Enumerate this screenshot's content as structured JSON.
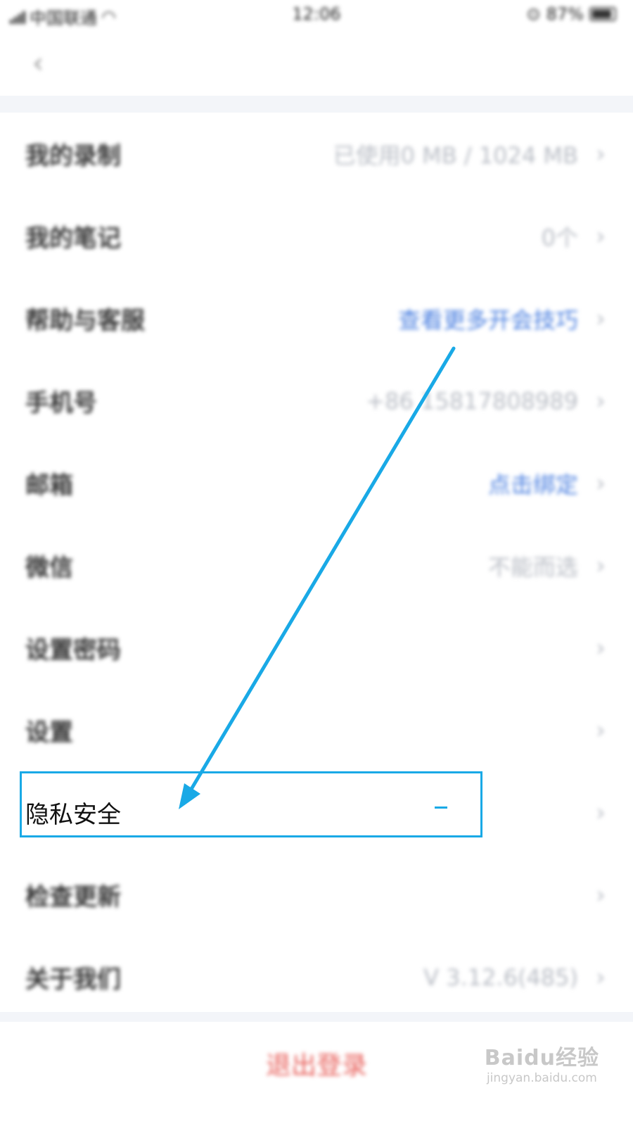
{
  "status_bar": {
    "carrier": "中国联通",
    "time": "12:06",
    "battery": "87%"
  },
  "nav": {
    "back_icon": "chevron-left-icon"
  },
  "rows": [
    {
      "label": "我的录制",
      "value": "已使用0 MB / 1024 MB",
      "link": false
    },
    {
      "label": "我的笔记",
      "value": "0个",
      "link": false
    },
    {
      "label": "帮助与客服",
      "value": "查看更多开会技巧",
      "link": true
    },
    {
      "label": "手机号",
      "value": "+86 15817808989",
      "link": false
    },
    {
      "label": "邮箱",
      "value": "点击绑定",
      "link": true
    },
    {
      "label": "微信",
      "value": "不能而选",
      "link": false
    },
    {
      "label": "设置密码",
      "value": "",
      "link": false
    },
    {
      "label": "设置",
      "value": "",
      "link": false
    },
    {
      "label": "隐私安全",
      "value": "",
      "link": false
    },
    {
      "label": "检查更新",
      "value": "",
      "link": false
    },
    {
      "label": "关于我们",
      "value": "V 3.12.6(485)",
      "link": false
    }
  ],
  "logout_label": "退出登录",
  "watermark": {
    "main": "Baidu经验",
    "sub": "jingyan.baidu.com"
  },
  "colors": {
    "annotation": "#19a9e6",
    "link": "#4a7fe0",
    "logout": "#e8615c"
  }
}
